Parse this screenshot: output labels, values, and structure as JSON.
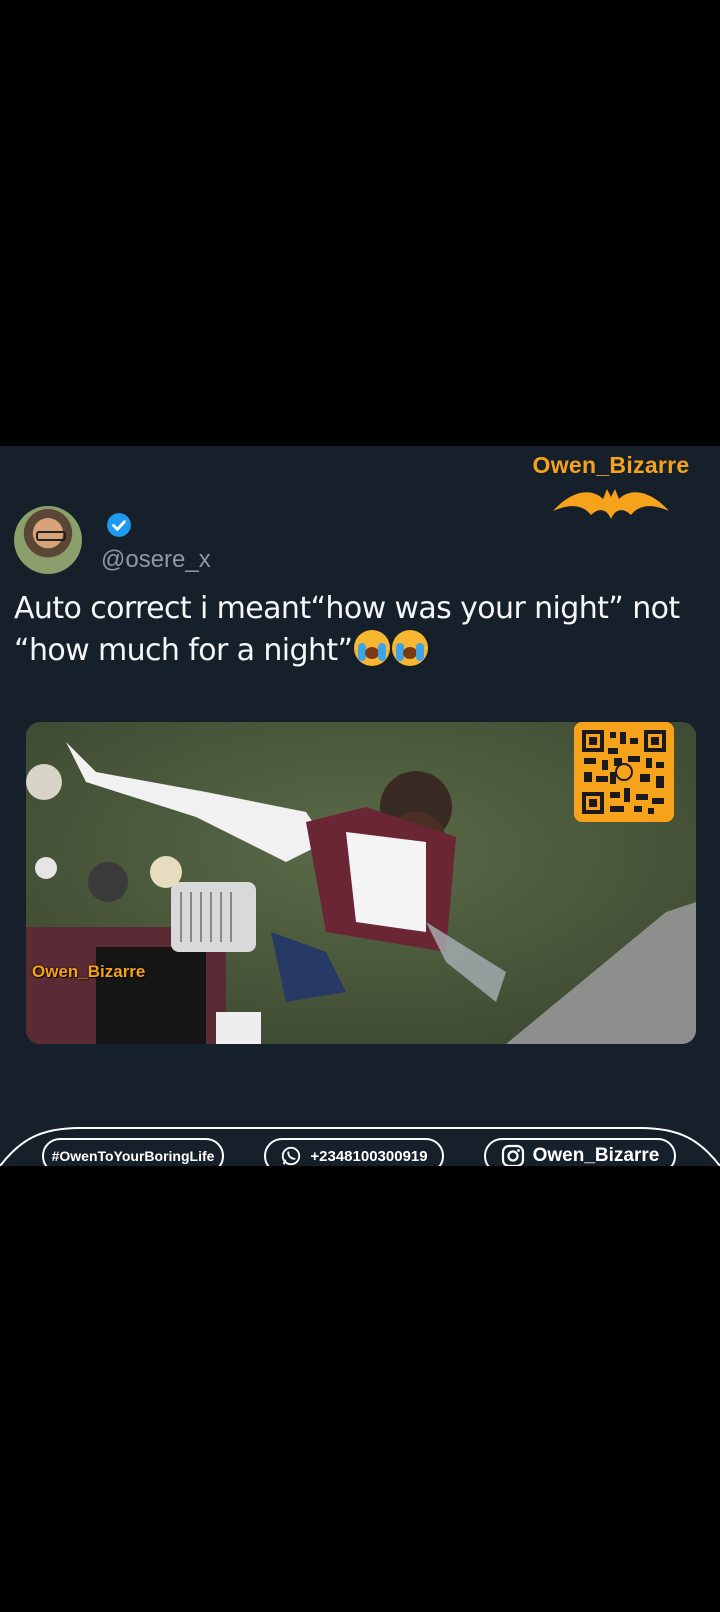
{
  "brand": {
    "name_top": "Owen_Bizarre",
    "name_photo": "Owen_Bizarre",
    "accent_color": "#f7a21b"
  },
  "tweet": {
    "handle": "@osere_x",
    "verified_icon": "verified-badge-icon",
    "text": "Auto correct i meant“how was your night” not “how much for a night”",
    "emoji": [
      "loudly-crying-face",
      "loudly-crying-face"
    ]
  },
  "footer": {
    "hashtag": "#OwenToYourBoringLife",
    "whatsapp": "+2348100300919",
    "instagram": "Owen_Bizarre"
  }
}
